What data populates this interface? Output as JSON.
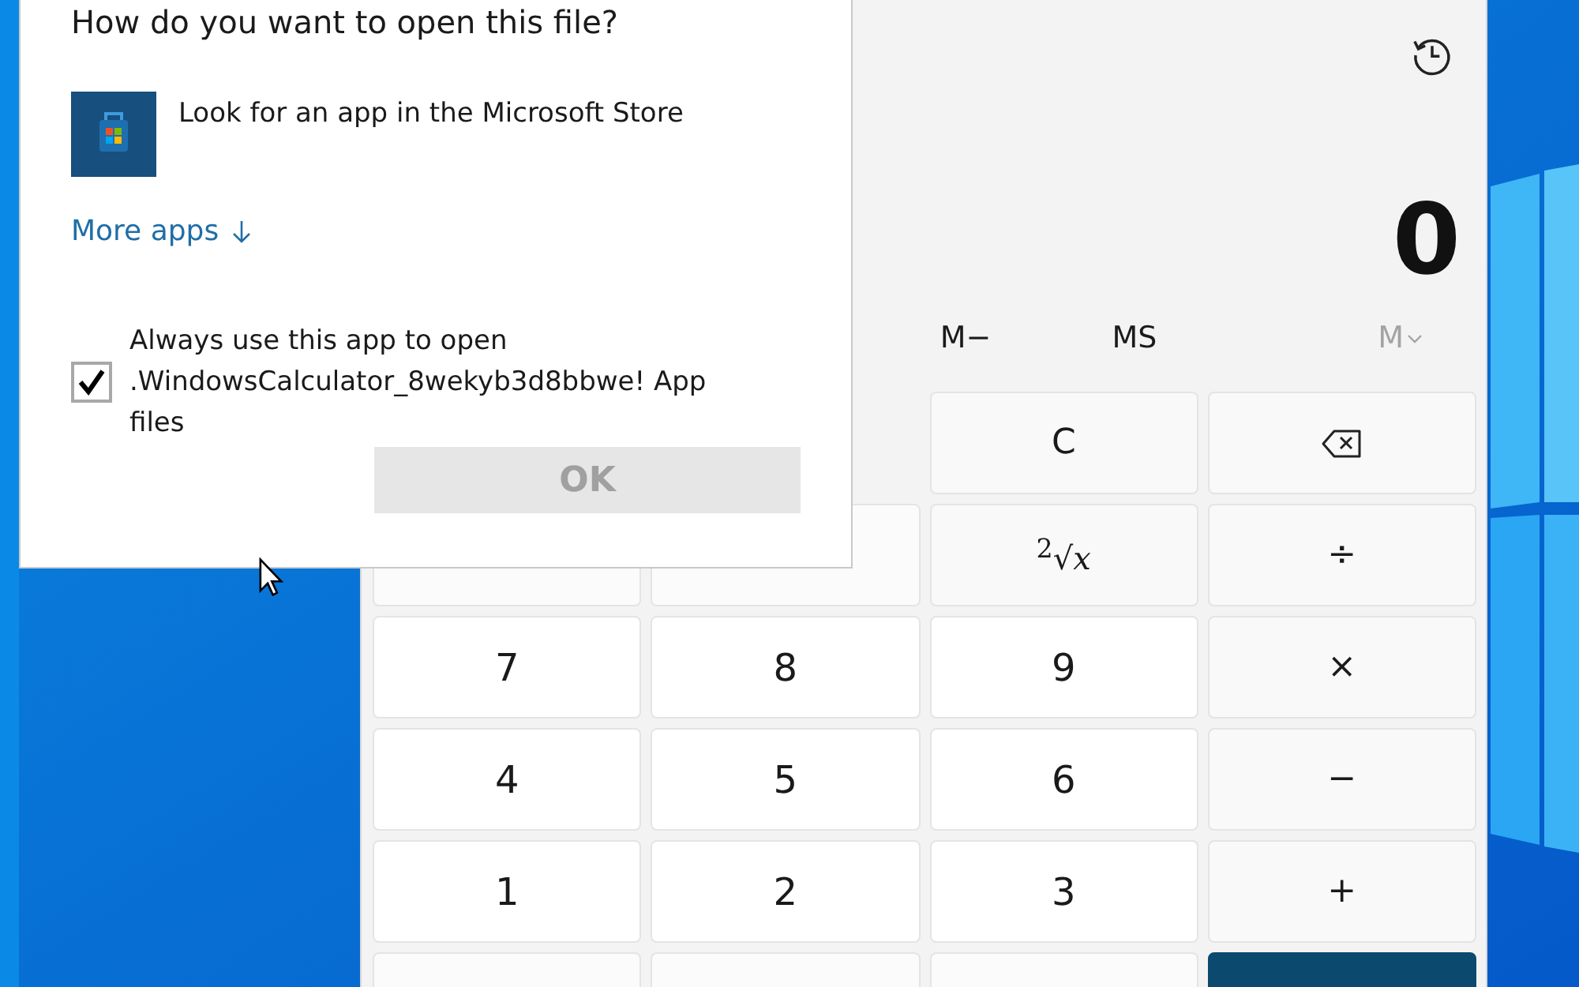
{
  "dialog": {
    "title": "How do you want to open this file?",
    "store_option": "Look for an app in the Microsoft Store",
    "more_apps": "More apps",
    "always_use": {
      "label": "Always use this app to open .WindowsCalculator_8wekyb3d8bbwe! App files",
      "checked": true
    },
    "ok_button": {
      "label": "OK",
      "disabled": true
    }
  },
  "calculator": {
    "display": "0",
    "memory": [
      {
        "label": "M−",
        "disabled": false,
        "kind": "plain"
      },
      {
        "label": "MS",
        "disabled": false,
        "kind": "plain"
      },
      {
        "label": "M",
        "disabled": true,
        "kind": "dropdown"
      }
    ],
    "keypad": [
      [
        {
          "kind": "op",
          "label": "C"
        },
        {
          "kind": "backspace"
        }
      ],
      [
        {
          "kind": "blank"
        },
        {
          "kind": "blank"
        },
        {
          "kind": "op",
          "label": "$^{2}$√*x*"
        },
        {
          "kind": "op",
          "label": "÷"
        }
      ],
      [
        {
          "kind": "digit",
          "label": "7"
        },
        {
          "kind": "digit",
          "label": "8"
        },
        {
          "kind": "digit",
          "label": "9"
        },
        {
          "kind": "op",
          "label": "×"
        }
      ],
      [
        {
          "kind": "digit",
          "label": "4"
        },
        {
          "kind": "digit",
          "label": "5"
        },
        {
          "kind": "digit",
          "label": "6"
        },
        {
          "kind": "op",
          "label": "−"
        }
      ],
      [
        {
          "kind": "digit",
          "label": "1"
        },
        {
          "kind": "digit",
          "label": "2"
        },
        {
          "kind": "digit",
          "label": "3"
        },
        {
          "kind": "op",
          "label": "+"
        }
      ],
      [
        {
          "kind": "blank"
        },
        {
          "kind": "blank"
        },
        {
          "kind": "blank"
        },
        {
          "kind": "accent"
        }
      ]
    ]
  }
}
